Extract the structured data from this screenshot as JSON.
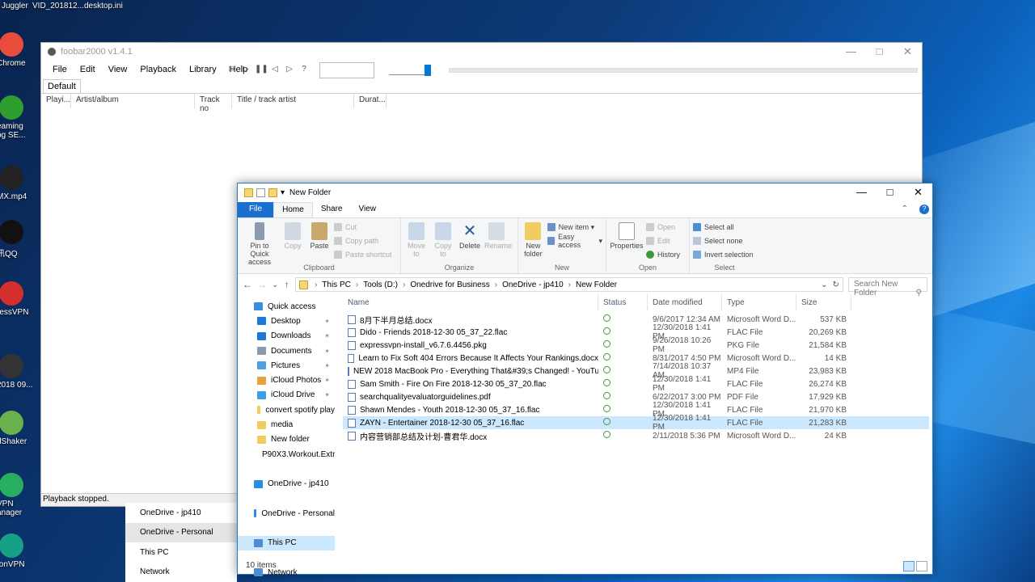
{
  "desktop": {
    "top_labels": [
      "Juggler",
      "VID_201812...",
      "desktop.ini"
    ],
    "icons": [
      {
        "label": "Chrome",
        "color": "#e74c3c"
      },
      {
        "label": "eaming\nog SE...",
        "color": "#2e9e2e"
      },
      {
        "label": "MX.mp4",
        "color": "#222222"
      },
      {
        "label": "讯QQ",
        "color": "#111111"
      },
      {
        "label": "ressVPN",
        "color": "#d32f2f"
      },
      {
        "label": "2018 09...",
        "color": "#333333"
      },
      {
        "label": "dShaker",
        "color": "#6ab04c"
      },
      {
        "label": "VPN\nanager",
        "color": "#27ae60"
      },
      {
        "label": "tonVPN",
        "color": "#16a085"
      }
    ]
  },
  "foobar": {
    "title": "foobar2000 v1.4.1",
    "menu": [
      "File",
      "Edit",
      "View",
      "Playback",
      "Library",
      "Help"
    ],
    "tab": "Default",
    "columns": [
      "Playi...",
      "Artist/album",
      "Track no",
      "Title / track artist",
      "Durat..."
    ],
    "status": "Playback stopped."
  },
  "bg_nav": [
    "OneDrive - jp410",
    "OneDrive - Personal",
    "This PC",
    "Network"
  ],
  "explorer": {
    "title": "New Folder",
    "ribbon_tabs": [
      "File",
      "Home",
      "Share",
      "View"
    ],
    "clipboard": {
      "pin": "Pin to Quick access",
      "copy": "Copy",
      "paste": "Paste",
      "cut": "Cut",
      "copy_path": "Copy path",
      "paste_shortcut": "Paste shortcut",
      "label": "Clipboard"
    },
    "organize": {
      "move": "Move to",
      "copy": "Copy to",
      "delete": "Delete",
      "rename": "Rename",
      "label": "Organize"
    },
    "new": {
      "folder": "New folder",
      "item": "New item",
      "easy": "Easy access",
      "label": "New"
    },
    "open": {
      "properties": "Properties",
      "open": "Open",
      "edit": "Edit",
      "history": "History",
      "label": "Open"
    },
    "select": {
      "all": "Select all",
      "none": "Select none",
      "invert": "Invert selection",
      "label": "Select"
    },
    "breadcrumb": [
      "This PC",
      "Tools (D:)",
      "Onedrive for Business",
      "OneDrive - jp410",
      "New Folder"
    ],
    "search_placeholder": "Search New Folder",
    "nav": [
      {
        "label": "Quick access",
        "color": "#3c8ce0",
        "pin": false,
        "indent": 20
      },
      {
        "label": "Desktop",
        "color": "#1e78d6",
        "pin": true,
        "indent": 24
      },
      {
        "label": "Downloads",
        "color": "#1e78d6",
        "pin": true,
        "indent": 24
      },
      {
        "label": "Documents",
        "color": "#8a9bb0",
        "pin": true,
        "indent": 24
      },
      {
        "label": "Pictures",
        "color": "#4aa0e0",
        "pin": true,
        "indent": 24
      },
      {
        "label": "iCloud Photos",
        "color": "#e8a23c",
        "pin": true,
        "indent": 24
      },
      {
        "label": "iCloud Drive",
        "color": "#3ca0e8",
        "pin": true,
        "indent": 24
      },
      {
        "label": "convert spotify play",
        "color": "#f2cc5c",
        "pin": false,
        "indent": 24
      },
      {
        "label": "media",
        "color": "#f2cc5c",
        "pin": false,
        "indent": 24
      },
      {
        "label": "New folder",
        "color": "#f2cc5c",
        "pin": false,
        "indent": 24
      },
      {
        "label": "P90X3.Workout.Extr",
        "color": "#f2cc5c",
        "pin": false,
        "indent": 24
      },
      {
        "label": "",
        "color": "",
        "pin": false,
        "indent": 0
      },
      {
        "label": "OneDrive - jp410",
        "color": "#2a8ee0",
        "pin": false,
        "indent": 20
      },
      {
        "label": "",
        "color": "",
        "pin": false,
        "indent": 0
      },
      {
        "label": "OneDrive - Personal",
        "color": "#2a8ee0",
        "pin": false,
        "indent": 20
      },
      {
        "label": "",
        "color": "",
        "pin": false,
        "indent": 0
      },
      {
        "label": "This PC",
        "color": "#4a8fd0",
        "pin": false,
        "indent": 20,
        "selected": true
      },
      {
        "label": "",
        "color": "",
        "pin": false,
        "indent": 0
      },
      {
        "label": "Network",
        "color": "#4a8fd0",
        "pin": false,
        "indent": 20
      }
    ],
    "columns": [
      "Name",
      "Status",
      "Date modified",
      "Type",
      "Size"
    ],
    "files": [
      {
        "name": "8月下半月总结.docx",
        "date": "9/6/2017 12:34 AM",
        "type": "Microsoft Word D...",
        "size": "537 KB"
      },
      {
        "name": "Dido - Friends 2018-12-30 05_37_22.flac",
        "date": "12/30/2018 1:41 PM",
        "type": "FLAC File",
        "size": "20,269 KB"
      },
      {
        "name": "expressvpn-install_v6.7.6.4456.pkg",
        "date": "9/26/2018 10:26 PM",
        "type": "PKG File",
        "size": "21,584 KB"
      },
      {
        "name": "Learn to Fix Soft 404 Errors Because It Affects Your Rankings.docx",
        "date": "8/31/2017 4:50 PM",
        "type": "Microsoft Word D...",
        "size": "14 KB"
      },
      {
        "name": "NEW 2018 MacBook Pro - Everything That&#39;s Changed! - YouTub...",
        "date": "7/14/2018 10:37 AM",
        "type": "MP4 File",
        "size": "23,983 KB"
      },
      {
        "name": "Sam Smith - Fire On Fire 2018-12-30 05_37_20.flac",
        "date": "12/30/2018 1:41 PM",
        "type": "FLAC File",
        "size": "26,274 KB"
      },
      {
        "name": "searchqualityevaluatorguidelines.pdf",
        "date": "6/22/2017 3:00 PM",
        "type": "PDF File",
        "size": "17,929 KB"
      },
      {
        "name": "Shawn Mendes - Youth 2018-12-30 05_37_16.flac",
        "date": "12/30/2018 1:41 PM",
        "type": "FLAC File",
        "size": "21,970 KB"
      },
      {
        "name": "ZAYN - Entertainer 2018-12-30 05_37_16.flac",
        "date": "12/30/2018 1:41 PM",
        "type": "FLAC File",
        "size": "21,283 KB",
        "selected": true
      },
      {
        "name": "内容营销部总结及计划-曹君华.docx",
        "date": "2/11/2018 5:36 PM",
        "type": "Microsoft Word D...",
        "size": "24 KB"
      }
    ],
    "item_count": "10 items"
  }
}
